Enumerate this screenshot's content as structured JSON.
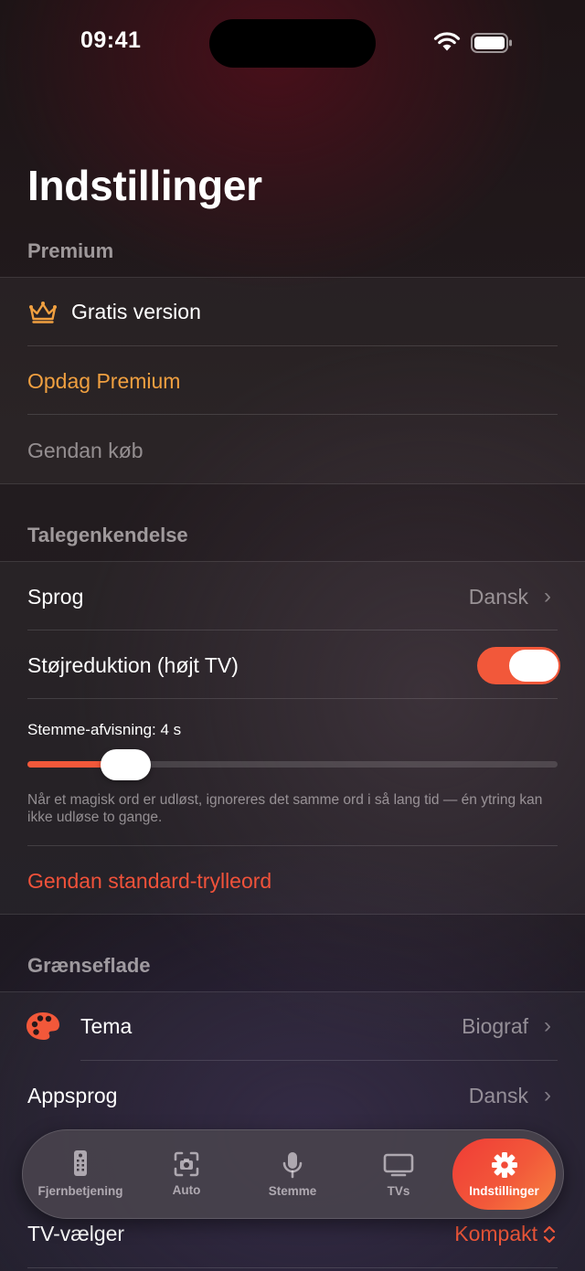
{
  "status_bar": {
    "time": "09:41"
  },
  "page": {
    "title": "Indstillinger"
  },
  "sections": {
    "premium": {
      "header": "Premium",
      "version_label": "Gratis version",
      "discover_label": "Opdag Premium",
      "restore_label": "Gendan køb"
    },
    "speech": {
      "header": "Talegenkendelse",
      "language_label": "Sprog",
      "language_value": "Dansk",
      "noise_label": "Støjreduktion (højt TV)",
      "noise_enabled": true,
      "cooldown_label": "Stemme-afvisning: 4 s",
      "cooldown_value_seconds": 4,
      "cooldown_help": "Når et magisk ord er udløst, ignoreres det samme ord i så lang tid — én ytring kan ikke udløse to gange.",
      "reset_label": "Gendan standard-trylleord"
    },
    "interface": {
      "header": "Grænseflade",
      "theme_label": "Tema",
      "theme_value": "Biograf",
      "app_language_label": "Appsprog",
      "app_language_value": "Dansk",
      "tv_picker_label": "TV-vælger",
      "tv_picker_value": "Kompakt"
    }
  },
  "tabbar": {
    "tabs": [
      {
        "label": "Fjernbetjening",
        "icon": "remote-icon"
      },
      {
        "label": "Auto",
        "icon": "camera-scan-icon"
      },
      {
        "label": "Stemme",
        "icon": "microphone-icon"
      },
      {
        "label": "TVs",
        "icon": "tv-icon"
      },
      {
        "label": "Indstillinger",
        "icon": "gear-icon",
        "active": true
      }
    ]
  },
  "colors": {
    "accent": "#f2583a",
    "premium_gold": "#f0a040",
    "destructive": "#f0523a"
  }
}
